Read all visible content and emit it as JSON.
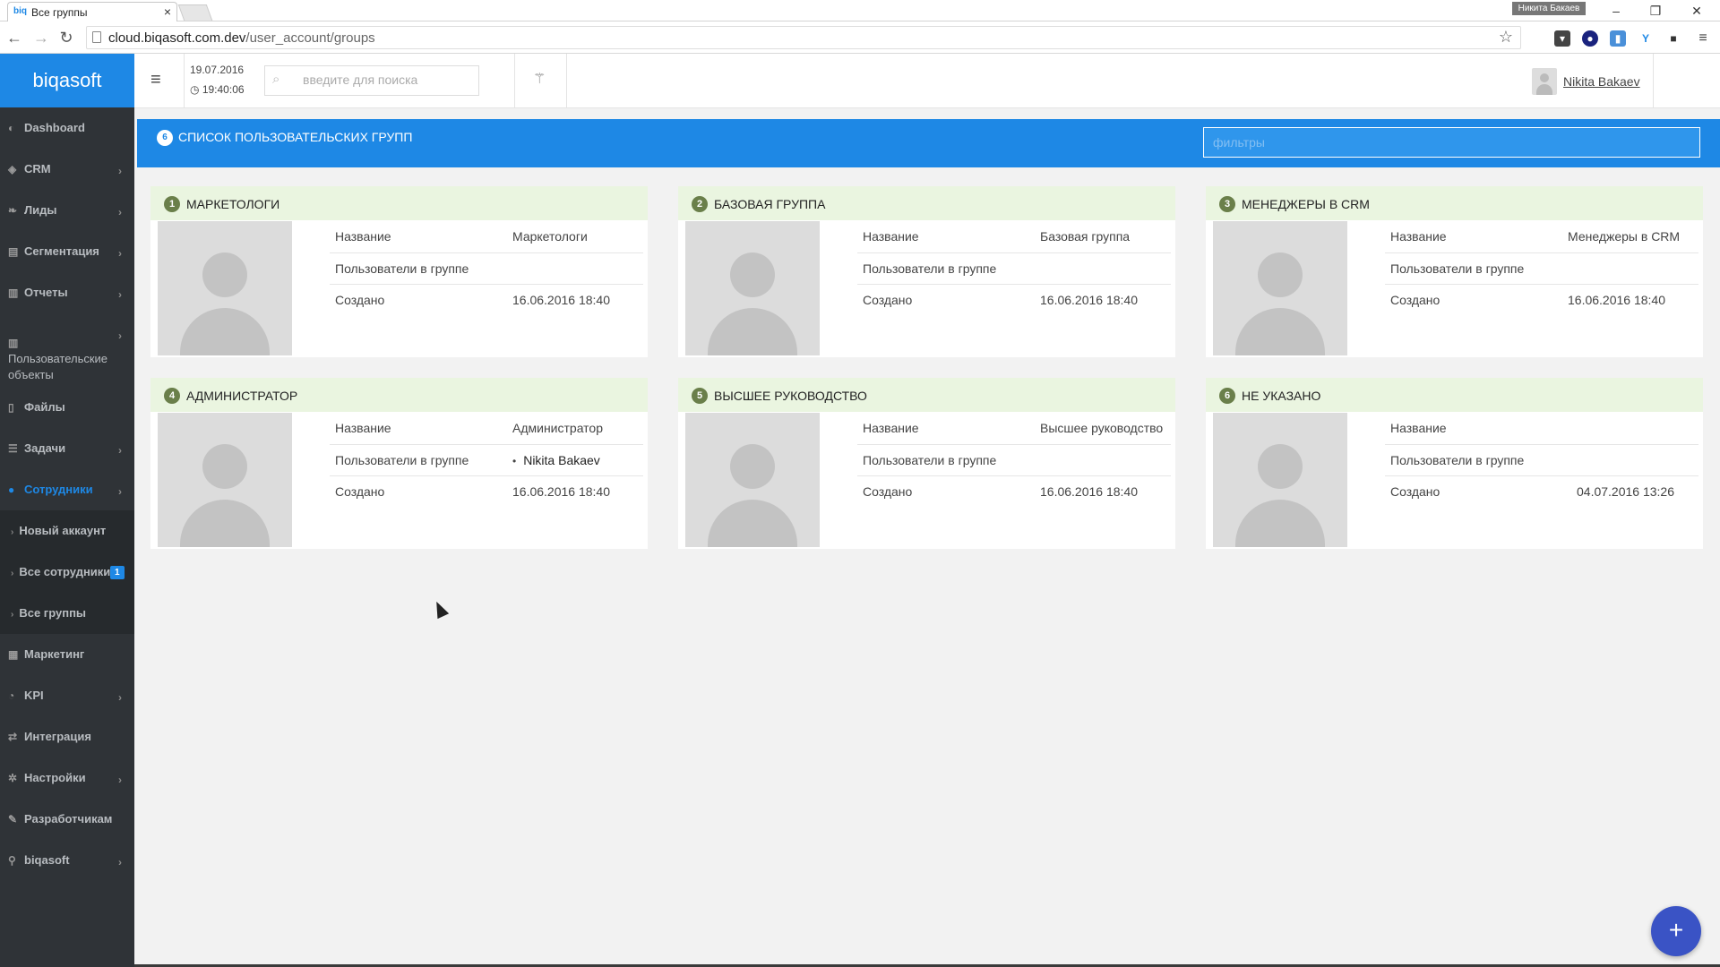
{
  "browser": {
    "tab_title": "Все группы",
    "tab_favicon": "biq",
    "profile_name": "Никита Бакаев",
    "url_host": "cloud.biqasoft.com.dev",
    "url_path": "/user_account/groups"
  },
  "sidebar": {
    "brand": "biqasoft",
    "items": [
      {
        "label": "Dashboard",
        "icon": "dashboard-icon"
      },
      {
        "label": "CRM",
        "icon": "cube-icon"
      },
      {
        "label": "Лиды",
        "icon": "leaf-icon"
      },
      {
        "label": "Сегментация",
        "icon": "cart-icon"
      },
      {
        "label": "Отчеты",
        "icon": "bank-icon"
      },
      {
        "label": "Пользовательские объекты",
        "icon": "bank-icon"
      },
      {
        "label": "Файлы",
        "icon": "file-icon"
      },
      {
        "label": "Задачи",
        "icon": "tasks-icon"
      },
      {
        "label": "Сотрудники",
        "icon": "users-icon"
      },
      {
        "label": "Маркетинг",
        "icon": "chart-icon"
      },
      {
        "label": "KPI",
        "icon": "pie-icon"
      },
      {
        "label": "Интеграция",
        "icon": "exchange-icon"
      },
      {
        "label": "Настройки",
        "icon": "gear-icon"
      },
      {
        "label": "Разработчикам",
        "icon": "wrench-icon"
      },
      {
        "label": "biqasoft",
        "icon": "pin-icon"
      }
    ],
    "subitems": [
      {
        "label": "Новый аккаунт"
      },
      {
        "label": "Все сотрудники",
        "badge": "1"
      },
      {
        "label": "Все группы"
      }
    ]
  },
  "header": {
    "date": "19.07.2016",
    "time": "19:40:06",
    "search_placeholder": "введите для поиска",
    "user_name": "Nikita Bakaev"
  },
  "section": {
    "count": "6",
    "title": "СПИСОК ПОЛЬЗОВАТЕЛЬСКИХ ГРУПП",
    "filter_placeholder": "фильтры"
  },
  "labels": {
    "name": "Название",
    "users": "Пользователи в группе",
    "created": "Создано"
  },
  "groups": [
    {
      "num": "1",
      "title": "Маркетологи",
      "name": "Маркетологи",
      "users": "",
      "created": "16.06.2016 18:40"
    },
    {
      "num": "2",
      "title": "Базовая группа",
      "name": "Базовая группа",
      "users": "",
      "created": "16.06.2016 18:40"
    },
    {
      "num": "3",
      "title": "Менеджеры в CRM",
      "name": "Менеджеры в CRM",
      "users": "",
      "created": "16.06.2016 18:40"
    },
    {
      "num": "4",
      "title": "Администратор",
      "name": "Администратор",
      "users": "Nikita Bakaev",
      "created": "16.06.2016 18:40"
    },
    {
      "num": "5",
      "title": "Высшее руководство",
      "name": "Высшее руководство",
      "users": "",
      "created": "16.06.2016 18:40"
    },
    {
      "num": "6",
      "title": "Не указано",
      "name": "",
      "users": "",
      "created": "04.07.2016 13:26"
    }
  ],
  "fab_label": "+"
}
